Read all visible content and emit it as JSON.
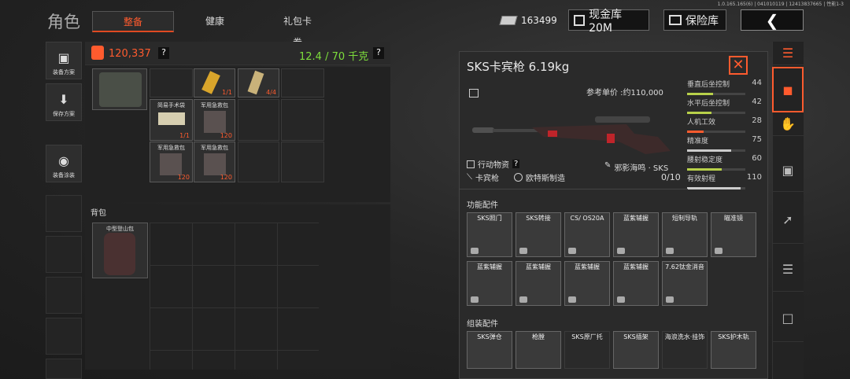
{
  "header": {
    "version": "1.0.165.165(6) | 041010119 | 12413837665 | 性能1-3",
    "page_title": "角色",
    "tabs": [
      {
        "label": "整备"
      },
      {
        "label": "健康"
      },
      {
        "label": "礼包卡券"
      }
    ],
    "money": "163499",
    "cash_button": "现金库 20M",
    "safe_button": "保险库",
    "back_icon": "chevron-left-icon"
  },
  "left_buttons": [
    {
      "label": "装备方案"
    },
    {
      "label": "保存方案"
    },
    {
      "label": "装备涂装"
    }
  ],
  "inventory": {
    "value": "120,337",
    "help": "?",
    "weight": "12.4 / 70 千克",
    "weight_help": "?",
    "items": [
      {
        "label": "",
        "count": "1/1"
      },
      {
        "label": "",
        "count": "4/4"
      },
      {
        "label": "简易手术袋",
        "count": "1/1"
      },
      {
        "label": "军用急救包",
        "count": "120"
      },
      {
        "label": "军用急救包",
        "count": "120"
      },
      {
        "label": "军用急救包",
        "count": "120"
      }
    ]
  },
  "backpack": {
    "title": "背包",
    "item_label": "中型登山包"
  },
  "detail": {
    "name": "SKS卡宾枪 6.19kg",
    "close_icon": "close-icon",
    "price": "参考单价 :约110,000",
    "tag_mission": "行动物资",
    "tag_help": "?",
    "tag_type": "卡宾枪",
    "tag_maker": "欧特斯制造",
    "skin": "邪影海鸣 · SKS",
    "skin_count": "0/10",
    "stats": [
      {
        "name": "垂直后坐控制",
        "value": "44",
        "level": 0.44,
        "color": "#b8d14a"
      },
      {
        "name": "水平后坐控制",
        "value": "42",
        "level": 0.42,
        "color": "#b8d14a"
      },
      {
        "name": "人机工效",
        "value": "28",
        "level": 0.28,
        "color": "#ff5b2e"
      },
      {
        "name": "精准度",
        "value": "75",
        "level": 0.75,
        "color": "#cccccc"
      },
      {
        "name": "腰射稳定度",
        "value": "60",
        "level": 0.6,
        "color": "#b8d14a"
      },
      {
        "name": "有效射程",
        "value": "110",
        "level": 0.92,
        "color": "#cccccc"
      }
    ],
    "func_title": "功能配件",
    "func_parts": [
      {
        "label": "SKS照门"
      },
      {
        "label": "SKS转接"
      },
      {
        "label": "CS/ OS20A"
      },
      {
        "label": "蓝紫辅握"
      },
      {
        "label": "短制导轨"
      },
      {
        "label": "瞄准镜"
      },
      {
        "label": "蓝紫辅握"
      },
      {
        "label": "蓝紫辅握"
      },
      {
        "label": "蓝紫辅握"
      },
      {
        "label": "蓝紫辅握"
      },
      {
        "label": "7.62钛金消音"
      }
    ],
    "assembly_title": "组装配件",
    "assembly_parts": [
      {
        "label": "SKS弹仓"
      },
      {
        "label": "枪膛"
      },
      {
        "label": "SKS原厂托"
      },
      {
        "label": "SKS插架"
      },
      {
        "label": "海浪洗水·挂饰"
      },
      {
        "label": "SKS护木轨"
      }
    ]
  },
  "colors": {
    "accent": "#ff5b2e",
    "weight_green": "#7dde3c"
  }
}
